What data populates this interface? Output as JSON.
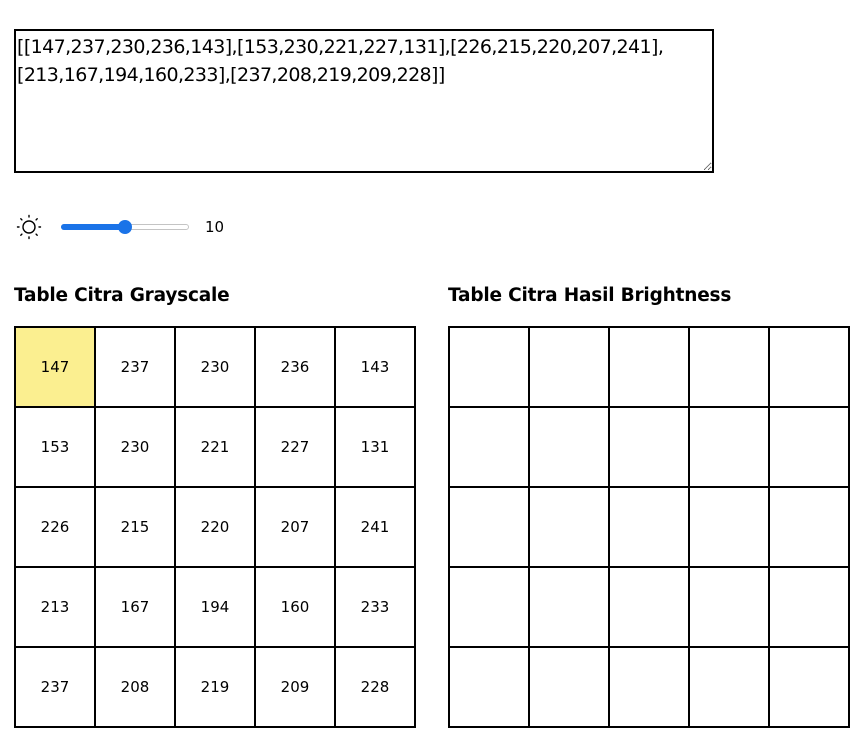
{
  "matrix_input": {
    "value": "[[147,237,230,236,143],[153,230,221,227,131],[226,215,220,207,241],\n[213,167,194,160,233],[237,208,219,209,228]]"
  },
  "brightness": {
    "icon": "sun-icon",
    "value": "10",
    "slider_fraction": 0.5
  },
  "grayscale_table": {
    "title": "Table Citra Grayscale",
    "highlight_color": "#fbef90",
    "rows": [
      [
        "147",
        "237",
        "230",
        "236",
        "143"
      ],
      [
        "153",
        "230",
        "221",
        "227",
        "131"
      ],
      [
        "226",
        "215",
        "220",
        "207",
        "241"
      ],
      [
        "213",
        "167",
        "194",
        "160",
        "233"
      ],
      [
        "237",
        "208",
        "219",
        "209",
        "228"
      ]
    ]
  },
  "result_table": {
    "title": "Table Citra Hasil Brightness",
    "rows": [
      [
        "",
        "",
        "",
        "",
        ""
      ],
      [
        "",
        "",
        "",
        "",
        ""
      ],
      [
        "",
        "",
        "",
        "",
        ""
      ],
      [
        "",
        "",
        "",
        "",
        ""
      ],
      [
        "",
        "",
        "",
        "",
        ""
      ]
    ]
  },
  "colors": {
    "accent": "#1a73e8",
    "highlight": "#fbef90",
    "border": "#000000"
  }
}
